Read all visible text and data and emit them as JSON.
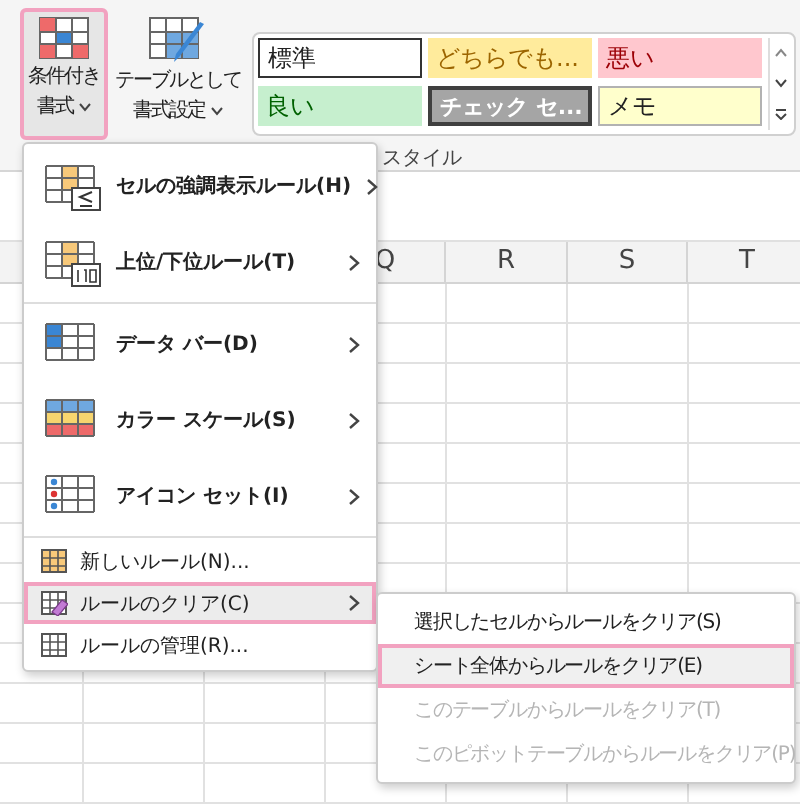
{
  "ribbon": {
    "buttons": [
      {
        "lines": [
          "条件付き",
          "書式"
        ],
        "selected": true
      },
      {
        "lines": [
          "テーブルとして",
          "書式設定"
        ],
        "selected": false
      }
    ],
    "styles": [
      {
        "label": "標準",
        "kind": "normal"
      },
      {
        "label": "どちらでも...",
        "kind": "neutral"
      },
      {
        "label": "悪い",
        "kind": "bad"
      },
      {
        "label": "良い",
        "kind": "good"
      },
      {
        "label": "チェック セ...",
        "kind": "check"
      },
      {
        "label": "メモ",
        "kind": "note"
      }
    ],
    "group_label": "スタイル"
  },
  "columns": [
    "Q",
    "R",
    "S",
    "T"
  ],
  "menu": {
    "items": [
      {
        "kind": "big",
        "label": "セルの強調表示ルール(H)",
        "submenu": true,
        "selected": false
      },
      {
        "kind": "big",
        "label": "上位/下位ルール(T)",
        "submenu": true,
        "selected": false
      },
      {
        "kind": "big",
        "label": "データ バー(D)",
        "submenu": true,
        "selected": false
      },
      {
        "kind": "big",
        "label": "カラー スケール(S)",
        "submenu": true,
        "selected": false
      },
      {
        "kind": "big",
        "label": "アイコン セット(I)",
        "submenu": true,
        "selected": false
      },
      {
        "kind": "small",
        "label": "新しいルール(N)...",
        "submenu": false,
        "selected": false
      },
      {
        "kind": "small",
        "label": "ルールのクリア(C)",
        "submenu": true,
        "selected": true
      },
      {
        "kind": "small",
        "label": "ルールの管理(R)...",
        "submenu": false,
        "selected": false
      }
    ]
  },
  "submenu": {
    "items": [
      {
        "label": "選択したセルからルールをクリア(S)",
        "selected": false,
        "disabled": false
      },
      {
        "label": "シート全体からルールをクリア(E)",
        "selected": true,
        "disabled": false
      },
      {
        "label": "このテーブルからルールをクリア(T)",
        "selected": false,
        "disabled": true
      },
      {
        "label": "このピボットテーブルからルールをクリア(P)",
        "selected": false,
        "disabled": true
      }
    ]
  }
}
